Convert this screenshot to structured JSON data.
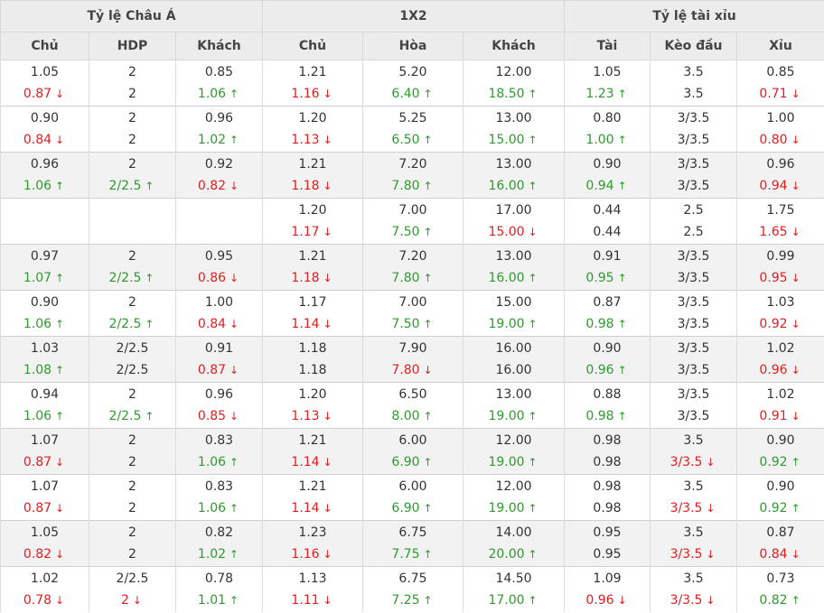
{
  "groups": [
    "Tỷ lệ Châu Á",
    "1X2",
    "Tỷ lệ tài xỉu"
  ],
  "columns": [
    "Chủ",
    "HDP",
    "Khách",
    "Chủ",
    "Hòa",
    "Khách",
    "Tài",
    "Kèo đầu",
    "Xỉu"
  ],
  "rows": [
    {
      "shade": false,
      "cells": [
        [
          {
            "v": "1.05"
          },
          {
            "v": "0.87",
            "t": "down"
          }
        ],
        [
          {
            "v": "2"
          },
          {
            "v": "2"
          }
        ],
        [
          {
            "v": "0.85"
          },
          {
            "v": "1.06",
            "t": "up"
          }
        ],
        [
          {
            "v": "1.21"
          },
          {
            "v": "1.16",
            "t": "down"
          }
        ],
        [
          {
            "v": "5.20"
          },
          {
            "v": "6.40",
            "t": "up"
          }
        ],
        [
          {
            "v": "12.00"
          },
          {
            "v": "18.50",
            "t": "up"
          }
        ],
        [
          {
            "v": "1.05"
          },
          {
            "v": "1.23",
            "t": "up"
          }
        ],
        [
          {
            "v": "3.5"
          },
          {
            "v": "3.5"
          }
        ],
        [
          {
            "v": "0.85"
          },
          {
            "v": "0.71",
            "t": "down"
          }
        ]
      ]
    },
    {
      "shade": false,
      "cells": [
        [
          {
            "v": "0.90"
          },
          {
            "v": "0.84",
            "t": "down"
          }
        ],
        [
          {
            "v": "2"
          },
          {
            "v": "2"
          }
        ],
        [
          {
            "v": "0.96"
          },
          {
            "v": "1.02",
            "t": "up"
          }
        ],
        [
          {
            "v": "1.20"
          },
          {
            "v": "1.13",
            "t": "down"
          }
        ],
        [
          {
            "v": "5.25"
          },
          {
            "v": "6.50",
            "t": "up"
          }
        ],
        [
          {
            "v": "13.00"
          },
          {
            "v": "15.00",
            "t": "up"
          }
        ],
        [
          {
            "v": "0.80"
          },
          {
            "v": "1.00",
            "t": "up"
          }
        ],
        [
          {
            "v": "3/3.5"
          },
          {
            "v": "3/3.5"
          }
        ],
        [
          {
            "v": "1.00"
          },
          {
            "v": "0.80",
            "t": "down"
          }
        ]
      ]
    },
    {
      "shade": true,
      "cells": [
        [
          {
            "v": "0.96"
          },
          {
            "v": "1.06",
            "t": "up"
          }
        ],
        [
          {
            "v": "2"
          },
          {
            "v": "2/2.5",
            "t": "up"
          }
        ],
        [
          {
            "v": "0.92"
          },
          {
            "v": "0.82",
            "t": "down"
          }
        ],
        [
          {
            "v": "1.21"
          },
          {
            "v": "1.18",
            "t": "down"
          }
        ],
        [
          {
            "v": "7.20"
          },
          {
            "v": "7.80",
            "t": "up"
          }
        ],
        [
          {
            "v": "13.00"
          },
          {
            "v": "16.00",
            "t": "up"
          }
        ],
        [
          {
            "v": "0.90"
          },
          {
            "v": "0.94",
            "t": "up"
          }
        ],
        [
          {
            "v": "3/3.5"
          },
          {
            "v": "3/3.5"
          }
        ],
        [
          {
            "v": "0.96"
          },
          {
            "v": "0.94",
            "t": "down"
          }
        ]
      ]
    },
    {
      "shade": false,
      "cells": [
        [
          {
            "v": ""
          },
          {
            "v": ""
          }
        ],
        [
          {
            "v": ""
          },
          {
            "v": ""
          }
        ],
        [
          {
            "v": ""
          },
          {
            "v": ""
          }
        ],
        [
          {
            "v": "1.20"
          },
          {
            "v": "1.17",
            "t": "down"
          }
        ],
        [
          {
            "v": "7.00"
          },
          {
            "v": "7.50",
            "t": "up"
          }
        ],
        [
          {
            "v": "17.00"
          },
          {
            "v": "15.00",
            "t": "down"
          }
        ],
        [
          {
            "v": "0.44"
          },
          {
            "v": "0.44"
          }
        ],
        [
          {
            "v": "2.5"
          },
          {
            "v": "2.5"
          }
        ],
        [
          {
            "v": "1.75"
          },
          {
            "v": "1.65",
            "t": "down"
          }
        ]
      ]
    },
    {
      "shade": true,
      "cells": [
        [
          {
            "v": "0.97"
          },
          {
            "v": "1.07",
            "t": "up"
          }
        ],
        [
          {
            "v": "2"
          },
          {
            "v": "2/2.5",
            "t": "up"
          }
        ],
        [
          {
            "v": "0.95"
          },
          {
            "v": "0.86",
            "t": "down"
          }
        ],
        [
          {
            "v": "1.21"
          },
          {
            "v": "1.18",
            "t": "down"
          }
        ],
        [
          {
            "v": "7.20"
          },
          {
            "v": "7.80",
            "t": "up"
          }
        ],
        [
          {
            "v": "13.00"
          },
          {
            "v": "16.00",
            "t": "up"
          }
        ],
        [
          {
            "v": "0.91"
          },
          {
            "v": "0.95",
            "t": "up"
          }
        ],
        [
          {
            "v": "3/3.5"
          },
          {
            "v": "3/3.5"
          }
        ],
        [
          {
            "v": "0.99"
          },
          {
            "v": "0.95",
            "t": "down"
          }
        ]
      ]
    },
    {
      "shade": false,
      "cells": [
        [
          {
            "v": "0.90"
          },
          {
            "v": "1.06",
            "t": "up"
          }
        ],
        [
          {
            "v": "2"
          },
          {
            "v": "2/2.5",
            "t": "up"
          }
        ],
        [
          {
            "v": "1.00"
          },
          {
            "v": "0.84",
            "t": "down"
          }
        ],
        [
          {
            "v": "1.17"
          },
          {
            "v": "1.14",
            "t": "down"
          }
        ],
        [
          {
            "v": "7.00"
          },
          {
            "v": "7.50",
            "t": "up"
          }
        ],
        [
          {
            "v": "15.00"
          },
          {
            "v": "19.00",
            "t": "up"
          }
        ],
        [
          {
            "v": "0.87"
          },
          {
            "v": "0.98",
            "t": "up"
          }
        ],
        [
          {
            "v": "3/3.5"
          },
          {
            "v": "3/3.5"
          }
        ],
        [
          {
            "v": "1.03"
          },
          {
            "v": "0.92",
            "t": "down"
          }
        ]
      ]
    },
    {
      "shade": true,
      "cells": [
        [
          {
            "v": "1.03"
          },
          {
            "v": "1.08",
            "t": "up"
          }
        ],
        [
          {
            "v": "2/2.5"
          },
          {
            "v": "2/2.5"
          }
        ],
        [
          {
            "v": "0.91"
          },
          {
            "v": "0.87",
            "t": "down"
          }
        ],
        [
          {
            "v": "1.18"
          },
          {
            "v": "1.18"
          }
        ],
        [
          {
            "v": "7.90"
          },
          {
            "v": "7.80",
            "t": "down"
          }
        ],
        [
          {
            "v": "16.00"
          },
          {
            "v": "16.00"
          }
        ],
        [
          {
            "v": "0.90"
          },
          {
            "v": "0.96",
            "t": "up"
          }
        ],
        [
          {
            "v": "3/3.5"
          },
          {
            "v": "3/3.5"
          }
        ],
        [
          {
            "v": "1.02"
          },
          {
            "v": "0.96",
            "t": "down"
          }
        ]
      ]
    },
    {
      "shade": false,
      "cells": [
        [
          {
            "v": "0.94"
          },
          {
            "v": "1.06",
            "t": "up"
          }
        ],
        [
          {
            "v": "2"
          },
          {
            "v": "2/2.5",
            "t": "up"
          }
        ],
        [
          {
            "v": "0.96"
          },
          {
            "v": "0.85",
            "t": "down"
          }
        ],
        [
          {
            "v": "1.20"
          },
          {
            "v": "1.13",
            "t": "down"
          }
        ],
        [
          {
            "v": "6.50"
          },
          {
            "v": "8.00",
            "t": "up"
          }
        ],
        [
          {
            "v": "13.00"
          },
          {
            "v": "19.00",
            "t": "up"
          }
        ],
        [
          {
            "v": "0.88"
          },
          {
            "v": "0.98",
            "t": "up"
          }
        ],
        [
          {
            "v": "3/3.5"
          },
          {
            "v": "3/3.5"
          }
        ],
        [
          {
            "v": "1.02"
          },
          {
            "v": "0.91",
            "t": "down"
          }
        ]
      ]
    },
    {
      "shade": true,
      "cells": [
        [
          {
            "v": "1.07"
          },
          {
            "v": "0.87",
            "t": "down"
          }
        ],
        [
          {
            "v": "2"
          },
          {
            "v": "2"
          }
        ],
        [
          {
            "v": "0.83"
          },
          {
            "v": "1.06",
            "t": "up"
          }
        ],
        [
          {
            "v": "1.21"
          },
          {
            "v": "1.14",
            "t": "down"
          }
        ],
        [
          {
            "v": "6.00"
          },
          {
            "v": "6.90",
            "t": "up"
          }
        ],
        [
          {
            "v": "12.00"
          },
          {
            "v": "19.00",
            "t": "up"
          }
        ],
        [
          {
            "v": "0.98"
          },
          {
            "v": "0.98"
          }
        ],
        [
          {
            "v": "3.5"
          },
          {
            "v": "3/3.5",
            "t": "down"
          }
        ],
        [
          {
            "v": "0.90"
          },
          {
            "v": "0.92",
            "t": "up"
          }
        ]
      ]
    },
    {
      "shade": false,
      "cells": [
        [
          {
            "v": "1.07"
          },
          {
            "v": "0.87",
            "t": "down"
          }
        ],
        [
          {
            "v": "2"
          },
          {
            "v": "2"
          }
        ],
        [
          {
            "v": "0.83"
          },
          {
            "v": "1.06",
            "t": "up"
          }
        ],
        [
          {
            "v": "1.21"
          },
          {
            "v": "1.14",
            "t": "down"
          }
        ],
        [
          {
            "v": "6.00"
          },
          {
            "v": "6.90",
            "t": "up"
          }
        ],
        [
          {
            "v": "12.00"
          },
          {
            "v": "19.00",
            "t": "up"
          }
        ],
        [
          {
            "v": "0.98"
          },
          {
            "v": "0.98"
          }
        ],
        [
          {
            "v": "3.5"
          },
          {
            "v": "3/3.5",
            "t": "down"
          }
        ],
        [
          {
            "v": "0.90"
          },
          {
            "v": "0.92",
            "t": "up"
          }
        ]
      ]
    },
    {
      "shade": true,
      "cells": [
        [
          {
            "v": "1.05"
          },
          {
            "v": "0.82",
            "t": "down"
          }
        ],
        [
          {
            "v": "2"
          },
          {
            "v": "2"
          }
        ],
        [
          {
            "v": "0.82"
          },
          {
            "v": "1.02",
            "t": "up"
          }
        ],
        [
          {
            "v": "1.23"
          },
          {
            "v": "1.16",
            "t": "down"
          }
        ],
        [
          {
            "v": "6.75"
          },
          {
            "v": "7.75",
            "t": "up"
          }
        ],
        [
          {
            "v": "14.00"
          },
          {
            "v": "20.00",
            "t": "up"
          }
        ],
        [
          {
            "v": "0.95"
          },
          {
            "v": "0.95"
          }
        ],
        [
          {
            "v": "3.5"
          },
          {
            "v": "3/3.5",
            "t": "down"
          }
        ],
        [
          {
            "v": "0.87"
          },
          {
            "v": "0.84",
            "t": "down"
          }
        ]
      ]
    },
    {
      "shade": false,
      "cells": [
        [
          {
            "v": "1.02"
          },
          {
            "v": "0.78",
            "t": "down"
          }
        ],
        [
          {
            "v": "2/2.5"
          },
          {
            "v": "2",
            "t": "down"
          }
        ],
        [
          {
            "v": "0.78"
          },
          {
            "v": "1.01",
            "t": "up"
          }
        ],
        [
          {
            "v": "1.13"
          },
          {
            "v": "1.11",
            "t": "down"
          }
        ],
        [
          {
            "v": "6.75"
          },
          {
            "v": "7.25",
            "t": "up"
          }
        ],
        [
          {
            "v": "14.50"
          },
          {
            "v": "17.00",
            "t": "up"
          }
        ],
        [
          {
            "v": "1.09"
          },
          {
            "v": "0.96",
            "t": "down"
          }
        ],
        [
          {
            "v": "3.5"
          },
          {
            "v": "3/3.5",
            "t": "down"
          }
        ],
        [
          {
            "v": "0.73"
          },
          {
            "v": "0.82",
            "t": "up"
          }
        ]
      ]
    }
  ],
  "colors": {
    "up": "#2e9b2e",
    "down": "#e02020",
    "header_bg": "#ececec",
    "shade_bg": "#f2f2f2"
  },
  "icons": {
    "up": "arrow-up-icon",
    "down": "arrow-down-icon"
  }
}
